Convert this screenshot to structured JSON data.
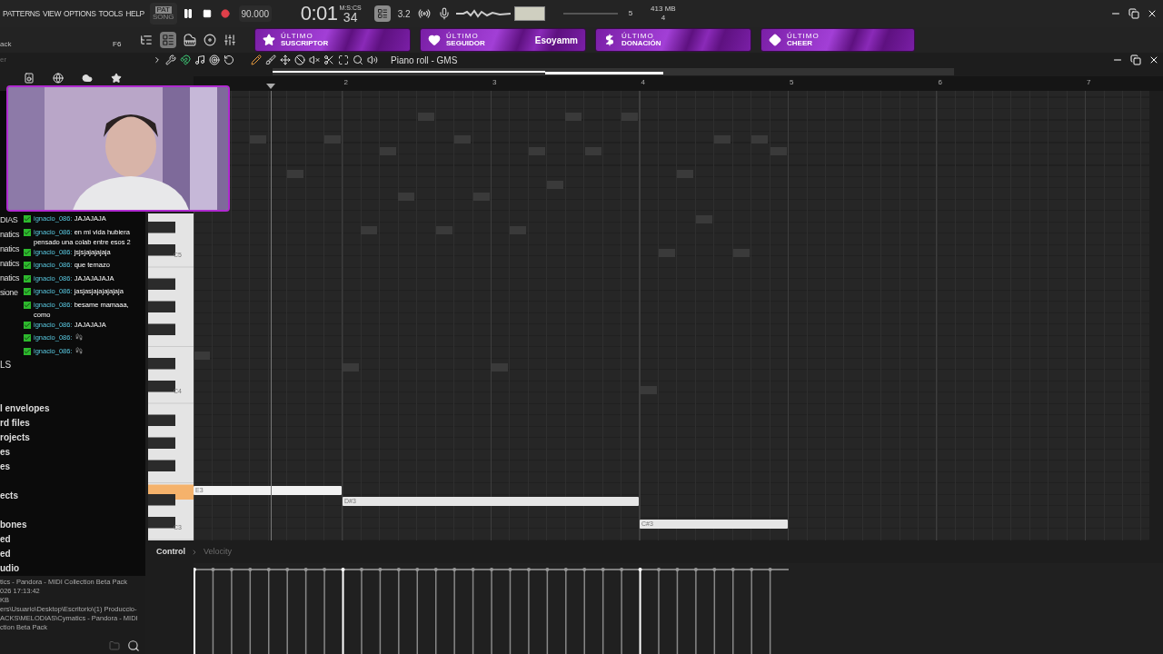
{
  "menu": [
    "PATTERNS",
    "VIEW",
    "OPTIONS",
    "TOOLS",
    "HELP"
  ],
  "transport": {
    "pat_label": "PAT",
    "song_label": "SONG",
    "pattern_mode": true,
    "recording": true,
    "tempo": "90.000",
    "time": "0:01",
    "time_cs": "34",
    "time_unit": "M:S:CS",
    "snap": "3.2",
    "cpu": "5",
    "memory": "413 MB",
    "polyphony": "4"
  },
  "toolbar": {
    "left_text": "ack",
    "shortcut": "F6"
  },
  "banners": [
    {
      "kind": "star",
      "top": "ÚLTIMO",
      "bottom": "SUSCRIPTOR"
    },
    {
      "kind": "heart",
      "top": "ÚLTIMO",
      "bottom": "SEGUIDOR",
      "name": "Esoyamm"
    },
    {
      "kind": "dollar",
      "top": "ÚLTIMO",
      "bottom": "DONACIÓN"
    },
    {
      "kind": "diamond",
      "top": "ÚLTIMO",
      "bottom": "CHEER"
    }
  ],
  "browser": {
    "header": "er",
    "upper": [
      "DIAS",
      "natics",
      "natics",
      "natics",
      "natics",
      "sione"
    ],
    "middle": [
      "LS"
    ],
    "lower": [
      [
        "l envelopes",
        "rd files",
        "rojects",
        "es",
        "es"
      ],
      [
        "ects"
      ],
      [
        "bones",
        "ed",
        "ed",
        "udio"
      ]
    ],
    "info": [
      "tics - Pandora - MIDI Collection Beta Pack",
      "026 17:13:42",
      "KB",
      "ers\\Usuario\\Desktop\\Escritorio\\(1) Produccio-",
      "ACKS\\MELODIAS\\Cymatics - Pandora - MIDI",
      "ction Beta Pack"
    ]
  },
  "chat": [
    {
      "kind": "text",
      "user": "ignacio_086:",
      "text": "JAJAJAJA"
    },
    {
      "kind": "text",
      "user": "ignacio_086:",
      "text": "en mi vida hubiera pensado una colab entre esos 2"
    },
    {
      "kind": "text",
      "user": "ignacio_086:",
      "text": "jsjsjajajajaja"
    },
    {
      "kind": "text",
      "user": "ignacio_086:",
      "text": "que temazo"
    },
    {
      "kind": "text",
      "user": "ignacio_086:",
      "text": "JAJAJAJAJA"
    },
    {
      "kind": "text",
      "user": "ignacio_086:",
      "text": "jasjasjajajajajaja"
    },
    {
      "kind": "text",
      "user": "ignacio_086:",
      "text": "besame mamaaa, como"
    },
    {
      "kind": "text",
      "user": "ignacio_086:",
      "text": "JAJAJAJA"
    },
    {
      "kind": "emote",
      "user": "ignacio_086:"
    },
    {
      "kind": "emote",
      "user": "ignacio_086:"
    }
  ],
  "piano_roll": {
    "title": "Piano roll - GMS",
    "bars": [
      "2",
      "3",
      "4",
      "5",
      "6",
      "7"
    ],
    "key_labels": [
      "C5",
      "C4",
      "C3"
    ],
    "notes": [
      {
        "label": "E3",
        "playing": true
      },
      {
        "label": "D#3",
        "playing": false
      },
      {
        "label": "C#3",
        "playing": false
      }
    ],
    "control_label": "Control",
    "control_target": "Velocity"
  }
}
